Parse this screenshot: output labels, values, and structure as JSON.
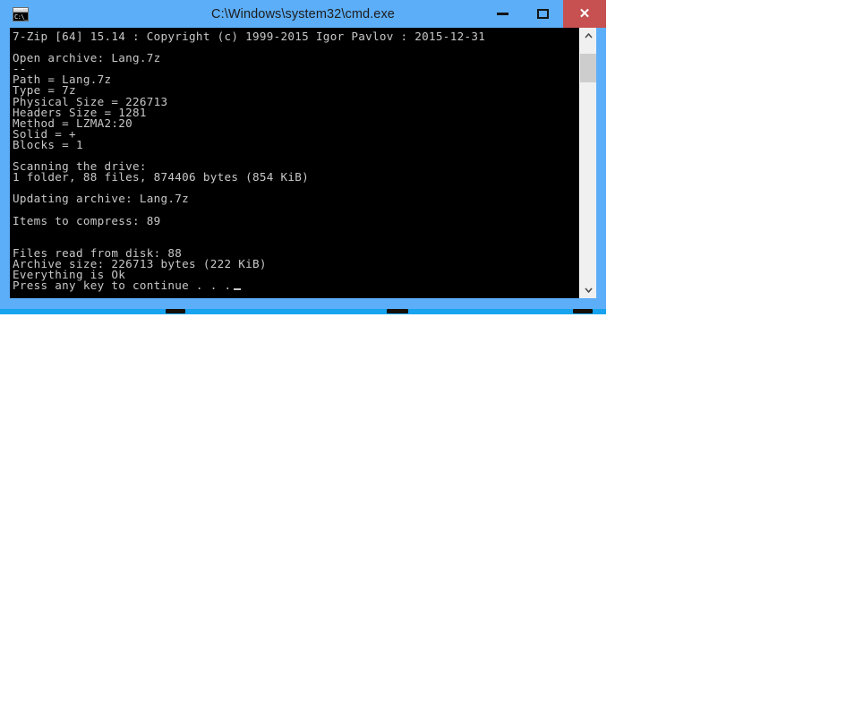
{
  "window": {
    "title": "C:\\Windows\\system32\\cmd.exe",
    "icon_name": "cmd-icon",
    "icon_text": "C:\\_",
    "titlebar_color": "#5daef8",
    "close_button_color": "#c75050",
    "controls": {
      "minimize_label": "–",
      "maximize_label": "☐",
      "close_label": "✕"
    }
  },
  "console": {
    "background_color": "#000000",
    "text_color": "#c8c8c8",
    "lines": [
      "7-Zip [64] 15.14 : Copyright (c) 1999-2015 Igor Pavlov : 2015-12-31",
      "",
      "Open archive: Lang.7z",
      "--",
      "Path = Lang.7z",
      "Type = 7z",
      "Physical Size = 226713",
      "Headers Size = 1281",
      "Method = LZMA2:20",
      "Solid = +",
      "Blocks = 1",
      "",
      "Scanning the drive:",
      "1 folder, 88 files, 874406 bytes (854 KiB)",
      "",
      "Updating archive: Lang.7z",
      "",
      "Items to compress: 89",
      "",
      "",
      "Files read from disk: 88",
      "Archive size: 226713 bytes (222 KiB)",
      "Everything is Ok"
    ],
    "prompt_line": "Press any key to continue . . .",
    "cursor_visible": true
  },
  "scrollbar": {
    "up_arrow": "∧",
    "down_arrow": "∨",
    "thumb_position_percent": 4,
    "thumb_size_percent": 12
  }
}
